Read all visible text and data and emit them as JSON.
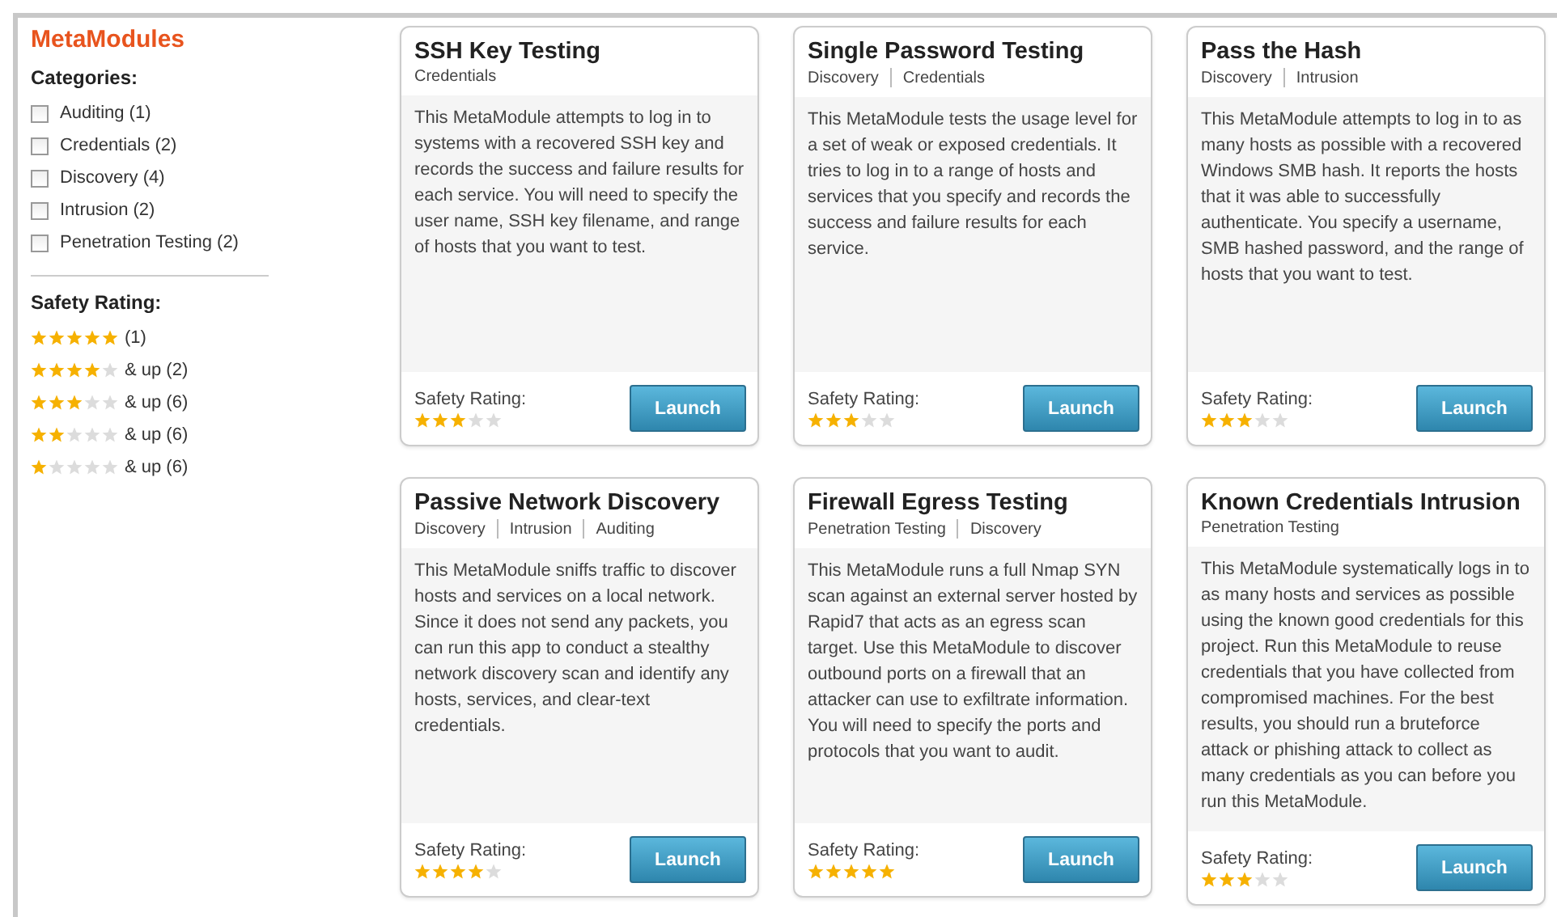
{
  "sidebar": {
    "title": "MetaModules",
    "categories_heading": "Categories:",
    "categories": [
      {
        "label": "Auditing (1)",
        "checked": false
      },
      {
        "label": "Credentials (2)",
        "checked": false
      },
      {
        "label": "Discovery (4)",
        "checked": false
      },
      {
        "label": "Intrusion (2)",
        "checked": false
      },
      {
        "label": "Penetration Testing (2)",
        "checked": false
      }
    ],
    "rating_heading": "Safety Rating:",
    "ratings": [
      {
        "stars": 5,
        "label": "(1)"
      },
      {
        "stars": 4,
        "label": "& up (2)"
      },
      {
        "stars": 3,
        "label": "& up (6)"
      },
      {
        "stars": 2,
        "label": "& up (6)"
      },
      {
        "stars": 1,
        "label": "& up (6)"
      }
    ]
  },
  "modules": [
    {
      "title": "SSH Key Testing",
      "tags": [
        "Credentials"
      ],
      "description": "This MetaModule attempts to log in to systems with a recovered SSH key and records the success and failure results for each service. You will need to specify the user name, SSH key filename, and range of hosts that you want to test.",
      "rating_label": "Safety Rating:",
      "stars": 3,
      "button": "Launch"
    },
    {
      "title": "Single Password Testing",
      "tags": [
        "Discovery",
        "Credentials"
      ],
      "description": "This MetaModule tests the usage level for a set of weak or exposed credentials. It tries to log in to a range of hosts and services that you specify and records the success and failure results for each service.",
      "rating_label": "Safety Rating:",
      "stars": 3,
      "button": "Launch"
    },
    {
      "title": "Pass the Hash",
      "tags": [
        "Discovery",
        "Intrusion"
      ],
      "description": "This MetaModule attempts to log in to as many hosts as possible with a recovered Windows SMB hash. It reports the hosts that it was able to successfully authenticate. You specify a username, SMB hashed password, and the range of hosts that you want to test.",
      "rating_label": "Safety Rating:",
      "stars": 3,
      "button": "Launch"
    },
    {
      "title": "Passive Network Discovery",
      "tags": [
        "Discovery",
        "Intrusion",
        "Auditing"
      ],
      "description": "This MetaModule sniffs traffic to discover hosts and services on a local network. Since it does not send any packets, you can run this app to conduct a stealthy network discovery scan and identify any hosts, services, and clear-text credentials.",
      "rating_label": "Safety Rating:",
      "stars": 4,
      "button": "Launch"
    },
    {
      "title": "Firewall Egress Testing",
      "tags": [
        "Penetration Testing",
        "Discovery"
      ],
      "description": "This MetaModule runs a full Nmap SYN scan against an external server hosted by Rapid7 that acts as an egress scan target. Use this MetaModule to discover outbound ports on a firewall that an attacker can use to exfiltrate information. You will need to specify the ports and protocols that you want to audit.",
      "rating_label": "Safety Rating:",
      "stars": 5,
      "button": "Launch"
    },
    {
      "title": "Known Credentials Intrusion",
      "tags": [
        "Penetration Testing"
      ],
      "description": "This MetaModule systematically logs in to as many hosts and services as possible using the known good credentials for this project. Run this MetaModule to reuse credentials that you have collected from compromised machines. For the best results, you should run a bruteforce attack or phishing attack to collect as many credentials as you can before you run this MetaModule.",
      "rating_label": "Safety Rating:",
      "stars": 3,
      "button": "Launch"
    }
  ]
}
